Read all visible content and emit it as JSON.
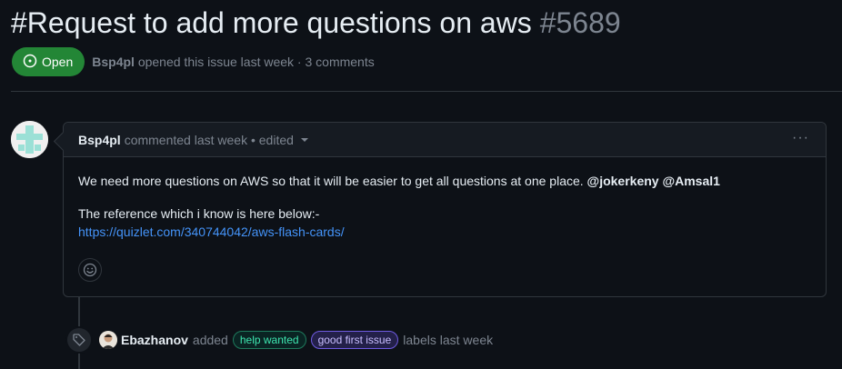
{
  "issue": {
    "title": "#Request to add more questions on aws",
    "number": "#5689",
    "state": "Open",
    "author": "Bsp4pl",
    "meta": "opened this issue last week · 3 comments"
  },
  "comment": {
    "author": "Bsp4pl",
    "meta": "commented last week • edited",
    "menu_label": "···",
    "body_line1": "We need more questions on AWS so that it will be easier to get all questions at one place.",
    "mention1": "@jokerkeny",
    "mention2": "@Amsal1",
    "body_line2": "The reference which i know is here below:-",
    "link": "https://quizlet.com/340744042/aws-flash-cards/"
  },
  "event": {
    "actor": "Ebazhanov",
    "action": "added",
    "labels": [
      {
        "name": "help wanted",
        "color": "#3ee6b0"
      },
      {
        "name": "good first issue",
        "color": "#c9bfff"
      }
    ],
    "suffix": "labels last week"
  },
  "colors": {
    "background": "#0d1117",
    "open_green": "#238636",
    "link_blue": "#4493f8",
    "muted": "#7d8590"
  },
  "icons": {
    "state": "issue-open-icon",
    "reaction": "smiley-icon",
    "event": "tag-icon"
  }
}
